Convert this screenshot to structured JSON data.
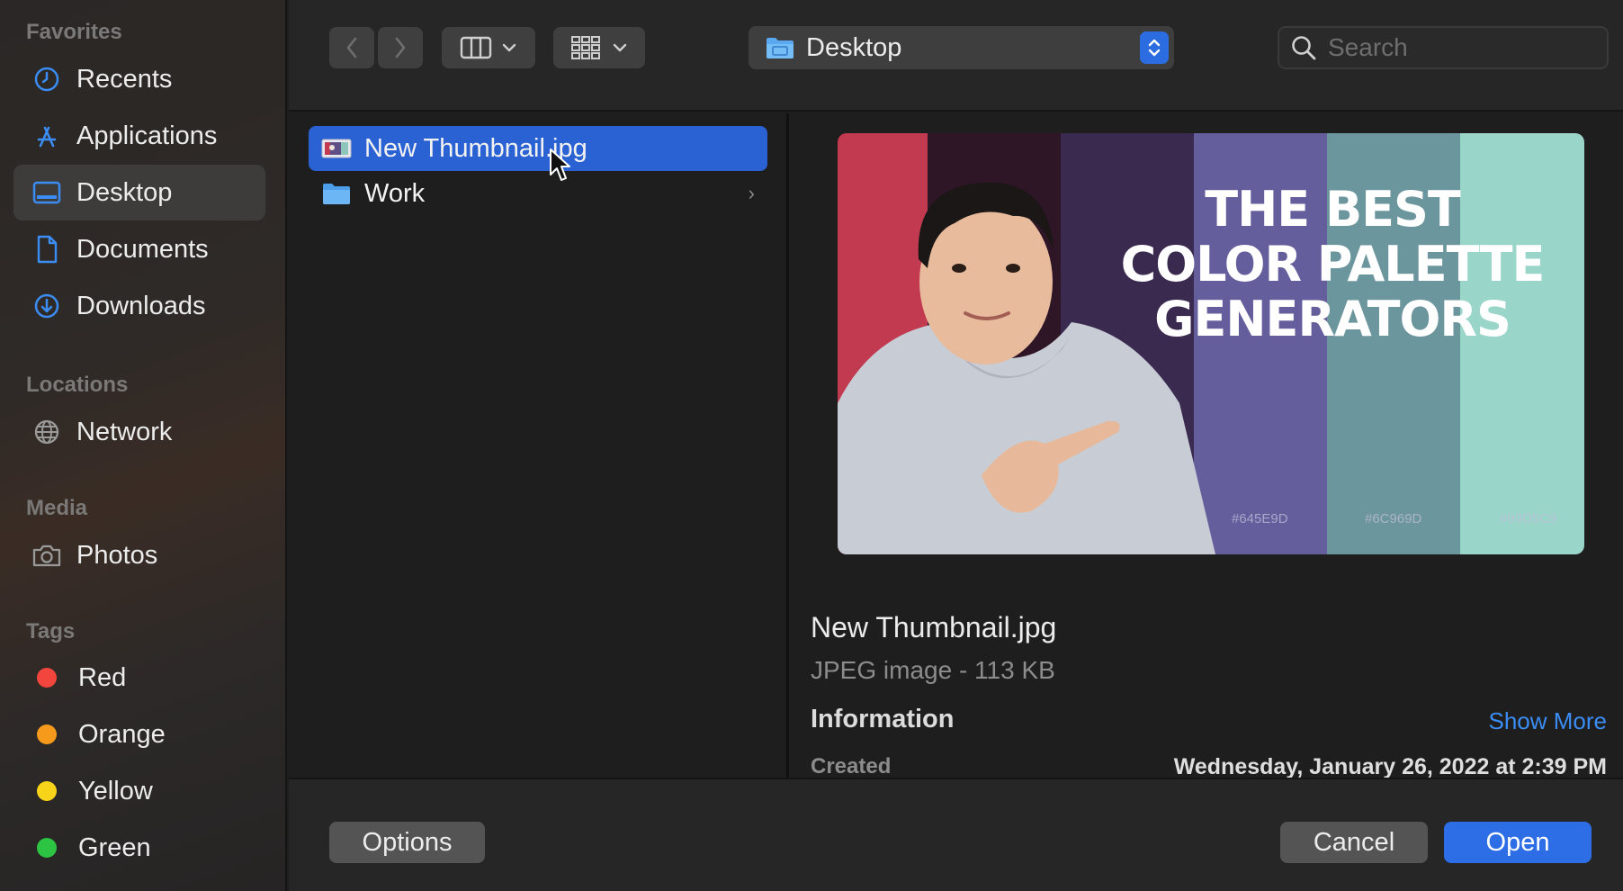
{
  "sidebar": {
    "sections": {
      "favorites": "Favorites",
      "locations": "Locations",
      "media": "Media",
      "tags": "Tags"
    },
    "favorites": [
      {
        "label": "Recents",
        "icon": "clock-icon"
      },
      {
        "label": "Applications",
        "icon": "applications-icon"
      },
      {
        "label": "Desktop",
        "icon": "desktop-icon",
        "active": true
      },
      {
        "label": "Documents",
        "icon": "document-icon"
      },
      {
        "label": "Downloads",
        "icon": "download-icon"
      }
    ],
    "locations": [
      {
        "label": "Network",
        "icon": "globe-icon"
      }
    ],
    "media": [
      {
        "label": "Photos",
        "icon": "camera-icon"
      }
    ],
    "tags": [
      {
        "label": "Red",
        "color": "#f1453d"
      },
      {
        "label": "Orange",
        "color": "#f59a1b"
      },
      {
        "label": "Yellow",
        "color": "#f7d31a"
      },
      {
        "label": "Green",
        "color": "#2dc443"
      }
    ]
  },
  "toolbar": {
    "location": "Desktop",
    "search_placeholder": "Search",
    "accent": "#2b6ce0"
  },
  "files": [
    {
      "name": "New Thumbnail.jpg",
      "icon": "image-file-icon",
      "selected": true
    },
    {
      "name": "Work",
      "icon": "folder-icon",
      "is_folder": true
    }
  ],
  "preview": {
    "thumbnail": {
      "title_lines": [
        "THE BEST",
        "COLOR PALETTE",
        "GENERATORS"
      ],
      "stripe_colors": [
        "#c23a4f",
        "#2e1627",
        "#3a2a50",
        "#645E9D",
        "#6C969D",
        "#99D5C9"
      ],
      "hex_labels": [
        "#645E9D",
        "#6C969D",
        "#99D5C9"
      ]
    },
    "name": "New Thumbnail.jpg",
    "kind": "JPEG image - 113 KB",
    "info_heading": "Information",
    "show_more": "Show More",
    "created_label": "Created",
    "created_value": "Wednesday, January 26, 2022 at 2:39 PM"
  },
  "footer": {
    "options": "Options",
    "cancel": "Cancel",
    "open": "Open"
  }
}
